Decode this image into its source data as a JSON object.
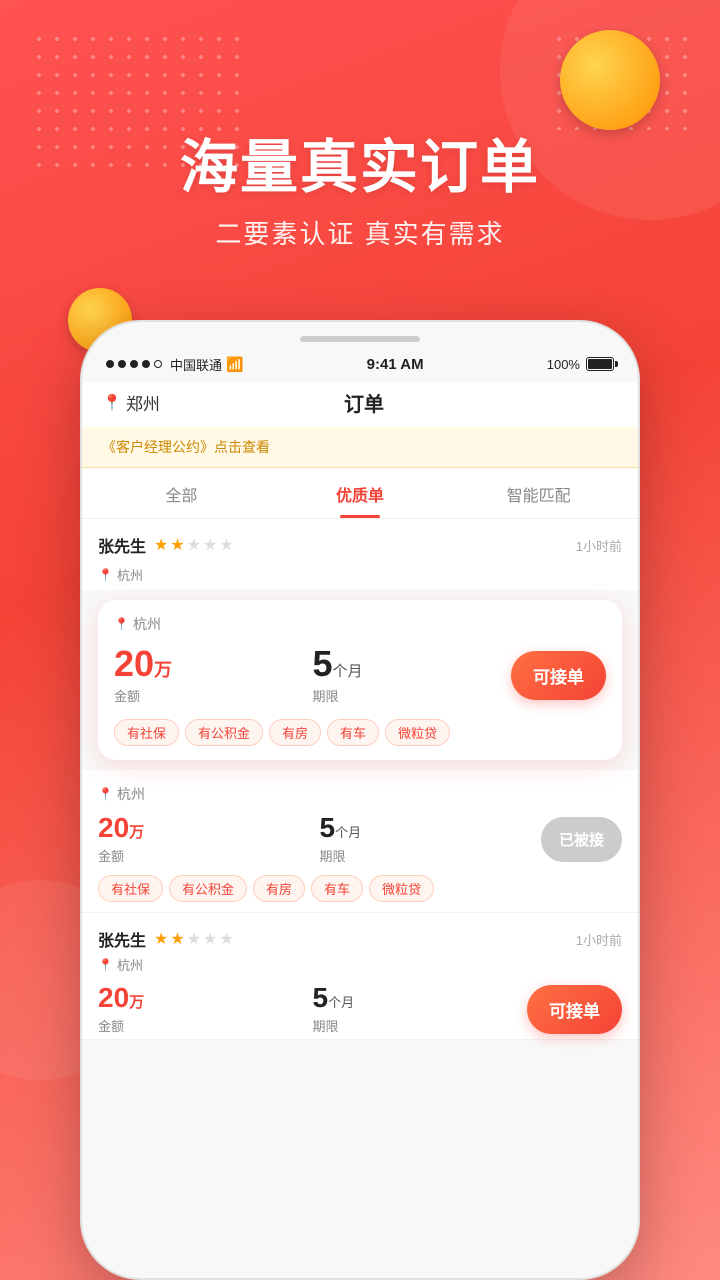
{
  "bg": {
    "color_start": "#ff5252",
    "color_end": "#ff8a80"
  },
  "hero": {
    "title": "海量真实订单",
    "subtitle": "二要素认证 真实有需求"
  },
  "phone": {
    "status_bar": {
      "carrier": "中国联通",
      "signal_dots": [
        "filled",
        "filled",
        "filled",
        "filled",
        "empty"
      ],
      "wifi": "WiFi",
      "time": "9:41 AM",
      "battery": "100%"
    },
    "header": {
      "location": "郑州",
      "title": "订单"
    },
    "banner": "《客户经理公约》点击查看",
    "tabs": [
      {
        "label": "全部",
        "active": false
      },
      {
        "label": "优质单",
        "active": true
      },
      {
        "label": "智能匹配",
        "active": false
      }
    ],
    "orders": [
      {
        "id": "order-1",
        "user": "张先生",
        "stars_filled": 2,
        "stars_empty": 3,
        "time_ago": "1小时前",
        "location": "杭州",
        "amount": "20",
        "amount_unit": "万",
        "amount_label": "金额",
        "period": "5",
        "period_unit": "个月",
        "period_label": "期限",
        "btn_label": "可接单",
        "btn_active": true,
        "tags": [
          "有社保",
          "有公积金",
          "有房",
          "有车",
          "微粒贷"
        ]
      },
      {
        "id": "order-2",
        "user": "",
        "stars_filled": 0,
        "stars_empty": 0,
        "time_ago": "",
        "location": "杭州",
        "amount": "20",
        "amount_unit": "万",
        "amount_label": "金额",
        "period": "5",
        "period_unit": "个月",
        "period_label": "期限",
        "btn_label": "已被接",
        "btn_active": false,
        "tags": [
          "有社保",
          "有公积金",
          "有房",
          "有车",
          "微粒贷"
        ]
      },
      {
        "id": "order-3",
        "user": "张先生",
        "stars_filled": 2,
        "stars_empty": 3,
        "time_ago": "1小时前",
        "location": "杭州",
        "amount": "20",
        "amount_unit": "万",
        "amount_label": "金额",
        "period": "5",
        "period_unit": "个月",
        "period_label": "期限",
        "btn_label": "可接单",
        "btn_active": true,
        "tags": []
      }
    ]
  }
}
